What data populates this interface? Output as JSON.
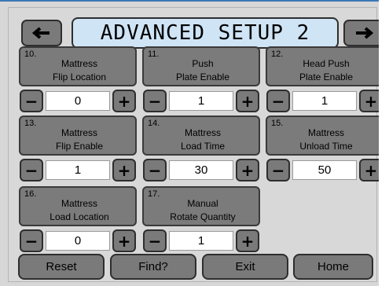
{
  "header": {
    "title": "ADVANCED SETUP 2",
    "prev_icon": "left-arrow",
    "next_icon": "right-arrow"
  },
  "params": [
    {
      "num": "10.",
      "line1": "Mattress",
      "line2": "Flip Location",
      "value": "0"
    },
    {
      "num": "11.",
      "line1": "Push",
      "line2": "Plate Enable",
      "value": "1"
    },
    {
      "num": "12.",
      "line1": "Head Push",
      "line2": "Plate Enable",
      "value": "1"
    },
    {
      "num": "13.",
      "line1": "Mattress",
      "line2": "Flip Enable",
      "value": "1"
    },
    {
      "num": "14.",
      "line1": "Mattress",
      "line2": "Load Time",
      "value": "30"
    },
    {
      "num": "15.",
      "line1": "Mattress",
      "line2": "Unload Time",
      "value": "50"
    },
    {
      "num": "16.",
      "line1": "Mattress",
      "line2": "Load Location",
      "value": "0"
    },
    {
      "num": "17.",
      "line1": "Manual",
      "line2": "Rotate Quantity",
      "value": "1"
    }
  ],
  "stepper": {
    "minus": "−",
    "plus": "+"
  },
  "footer": {
    "reset": "Reset",
    "find": "Find?",
    "exit": "Exit",
    "home": "Home"
  },
  "colors": {
    "button": "#7a7a7a",
    "title_bg": "#cfe4f5",
    "panel_bg": "#d8d8d8"
  }
}
